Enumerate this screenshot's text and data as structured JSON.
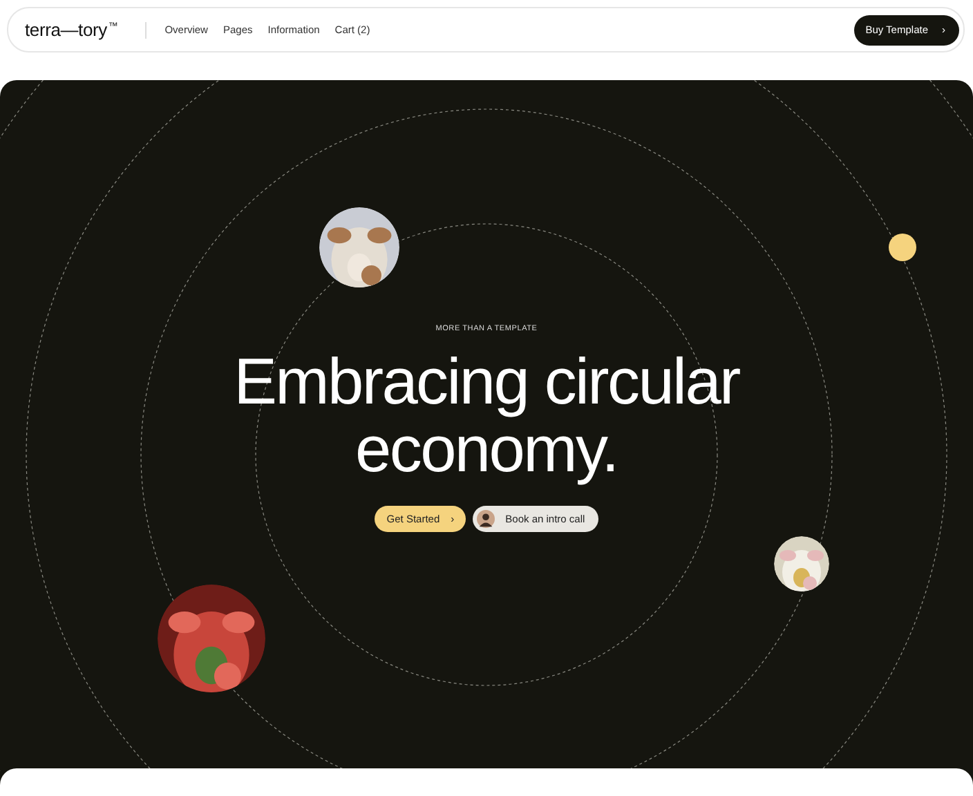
{
  "nav": {
    "logo": "terra—tory",
    "logo_mark": "™",
    "links": [
      {
        "label": "Overview"
      },
      {
        "label": "Pages"
      },
      {
        "label": "Information"
      },
      {
        "label": "Cart (2)"
      }
    ],
    "cta": {
      "label": "Buy Template",
      "icon": "›"
    }
  },
  "hero": {
    "eyebrow": "MORE THAN A TEMPLATE",
    "title_lines": [
      "Embracing circular",
      "economy."
    ],
    "buttons": [
      {
        "kind": "primary",
        "label": "Get Started",
        "icon": "›"
      },
      {
        "kind": "avatar",
        "label": "Book an intro call"
      }
    ],
    "orbs": [
      {
        "kind": "picture"
      },
      {
        "kind": "dot",
        "color": "#f5d37e"
      },
      {
        "kind": "picture"
      },
      {
        "kind": "picture"
      }
    ]
  }
}
